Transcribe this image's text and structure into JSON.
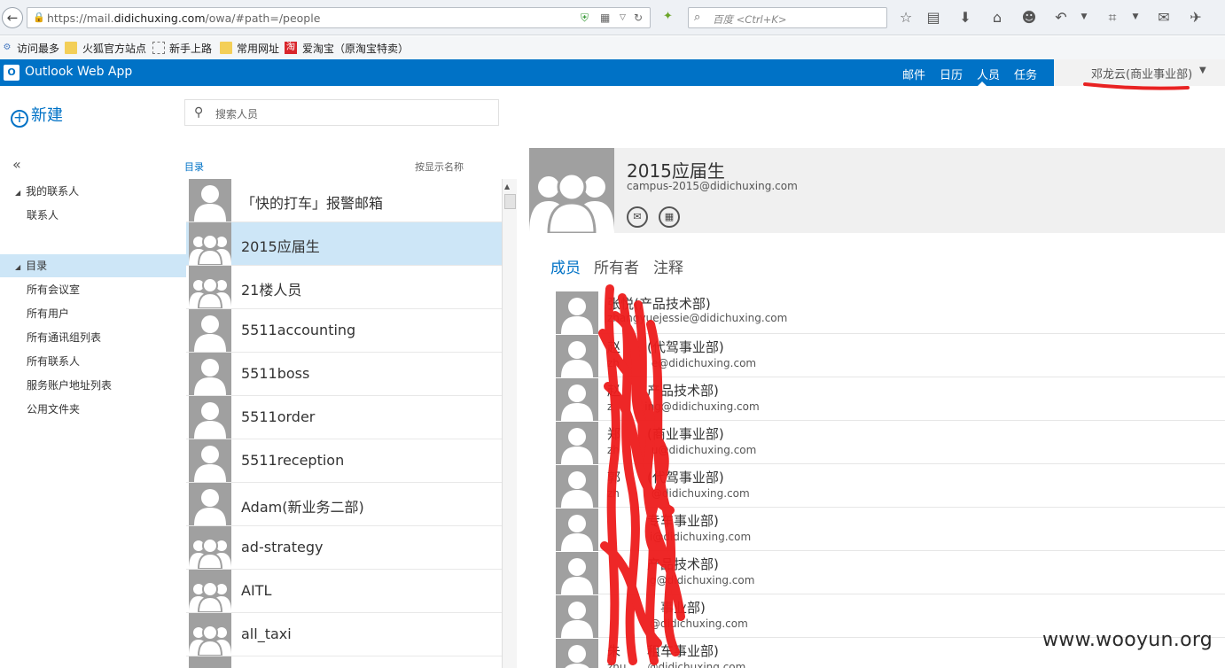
{
  "browser": {
    "url_prefix": "https://mail.",
    "url_domain": "didichuxing.com",
    "url_path": "/owa/#path=/people",
    "search_placeholder": "百度 <Ctrl+K>",
    "bookmarks": [
      "访问最多",
      "火狐官方站点",
      "新手上路",
      "常用网址",
      "爱淘宝（原淘宝特卖）"
    ]
  },
  "app": {
    "title": "Outlook Web App",
    "nav": [
      "邮件",
      "日历",
      "人员",
      "任务"
    ],
    "active_nav": "人员",
    "user": "邓龙云(商业事业部)",
    "brand_color": "#0072c6"
  },
  "left": {
    "new_label": "新建",
    "my_contacts": "我的联系人",
    "contacts": "联系人",
    "directory": "目录",
    "directory_items": [
      "所有会议室",
      "所有用户",
      "所有通讯组列表",
      "所有联系人",
      "服务账户地址列表",
      "公用文件夹"
    ]
  },
  "search": {
    "placeholder": "搜索人员",
    "scope_label": "目录",
    "sort_label": "按显示名称"
  },
  "contact_list": [
    {
      "name": "「快的打车」报警邮箱",
      "kind": "person"
    },
    {
      "name": "2015应届生",
      "kind": "group",
      "selected": true
    },
    {
      "name": "21楼人员",
      "kind": "group"
    },
    {
      "name": "5511accounting",
      "kind": "person"
    },
    {
      "name": "5511boss",
      "kind": "person"
    },
    {
      "name": "5511order",
      "kind": "person"
    },
    {
      "name": "5511reception",
      "kind": "person"
    },
    {
      "name": "Adam(新业务二部)",
      "kind": "person"
    },
    {
      "name": "ad-strategy",
      "kind": "group"
    },
    {
      "name": "AITL",
      "kind": "group"
    },
    {
      "name": "all_taxi",
      "kind": "group"
    },
    {
      "name": "",
      "kind": "group"
    }
  ],
  "detail": {
    "name": "2015应届生",
    "email": "campus-2015@didichuxing.com",
    "tabs": [
      "成员",
      "所有者",
      "注释"
    ],
    "active_tab": "成员",
    "members": [
      {
        "name": "张悦(产品技术部)",
        "email": "zhangyuejessie@didichuxing.com"
      },
      {
        "name": "赵　　(代驾事业部)",
        "email": "zh　　　e@didichuxing.com"
      },
      {
        "name": "赵　　产品技术部)",
        "email": "z　　　ing@didichuxing.com"
      },
      {
        "name": "郑　　(商业事业部)",
        "email": "zh　　　u@didichuxing.com"
      },
      {
        "name": "郭　　(代驾事业部)",
        "email": "zh　　　@didichuxing.com"
      },
      {
        "name": "　　　专车事业部)",
        "email": "　　　　i@didichuxing.com"
      },
      {
        "name": "　　　产品技术部)",
        "email": "　　　　g@didichuxing.com"
      },
      {
        "name": "　　　　事业部)",
        "email": "　　　　@didichuxing.com"
      },
      {
        "name": "朱　　租车事业部)",
        "email": "zhu　　@didichuxing.com"
      }
    ]
  },
  "watermark": "www.wooyun.org"
}
